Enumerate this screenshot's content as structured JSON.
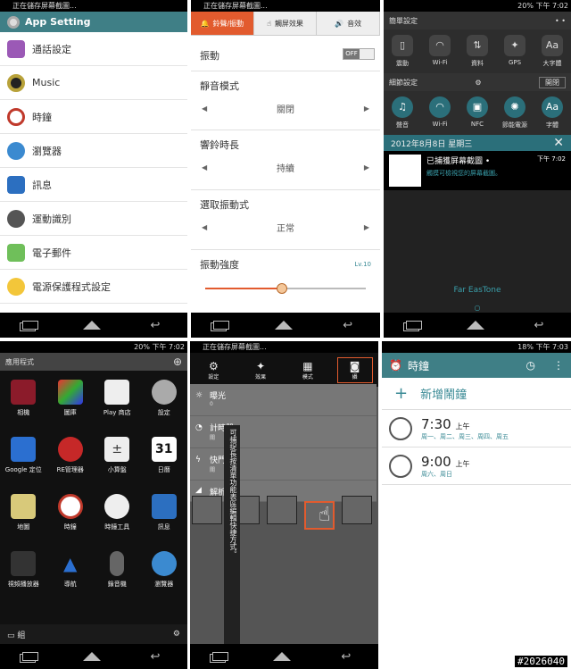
{
  "p1": {
    "status": "正在儲存屏幕截圖...",
    "title": "App Setting",
    "items": [
      "通話設定",
      "Music",
      "時鐘",
      "瀏覽器",
      "訊息",
      "運動識別",
      "電子郵件",
      "電源保護程式設定"
    ]
  },
  "p2": {
    "status": "正在儲存屏幕截圖...",
    "tabs": [
      "鈴聲/振動",
      "觸屏效果",
      "音效"
    ],
    "vibrate": "振動",
    "toggle": "OFF",
    "silent": "靜音模式",
    "silent_value": "關閉",
    "ring_len": "響鈴時長",
    "ring_len_value": "持續",
    "vib_mode": "選取振動式",
    "vib_mode_value": "正常",
    "vib_strength": "振動強度",
    "vib_level": "Lv.10",
    "vib_fraction": 0.48
  },
  "p3": {
    "status": "20%  下午 7:02",
    "quick": "簡單設定",
    "quick_items": [
      "震動",
      "Wi-Fi",
      "資料",
      "GPS",
      "大字體"
    ],
    "detail": "細節設定",
    "detail_btn": "開閉",
    "detail_items": [
      "聲音",
      "Wi-Fi",
      "NFC",
      "節能電源",
      "字體"
    ],
    "date": "2012年8月8日 星期三",
    "notif_title": "已捕獲屏幕截圖 •",
    "notif_time": "下午 7:02",
    "notif_body": "觸摸可檢視您的屏幕截圖。",
    "carrier": "Far EasTone"
  },
  "p4": {
    "status": "20%  下午 7:02",
    "header": "應用程式",
    "apps": [
      "相機",
      "圖庫",
      "Play 商店",
      "設定",
      "Google 定位",
      "RE管理器",
      "小算盤",
      "日曆",
      "地圖",
      "時鐘",
      "時鐘工具",
      "訊息",
      "視頻播放器",
      "導航",
      "錄音機",
      "瀏覽器"
    ],
    "calendar_day": "31",
    "group": "組"
  },
  "p5": {
    "status": "正在儲存屏幕截圖...",
    "tabs": [
      "設定",
      "效果",
      "模式",
      "攝"
    ],
    "menu": [
      {
        "t": "曝光",
        "s": "0"
      },
      {
        "t": "計時器",
        "s": "關"
      },
      {
        "t": "快門",
        "s": "關"
      },
      {
        "t": "解析",
        "s": ""
      }
    ],
    "tip": "可捕捉長按清單功能表區編輯快捷方式。"
  },
  "p6": {
    "status": "18%  下午 7:03",
    "title": "時鐘",
    "add": "新增鬧鐘",
    "alarms": [
      {
        "time": "7:30",
        "ampm": "上午",
        "days": "周一、周二、周三、周四、周五"
      },
      {
        "time": "9:00",
        "ampm": "上午",
        "days": "周六、周日"
      }
    ]
  },
  "watermark": "#2026040",
  "colors": {
    "teal": "#3f7f86",
    "orange": "#e25b2e"
  }
}
